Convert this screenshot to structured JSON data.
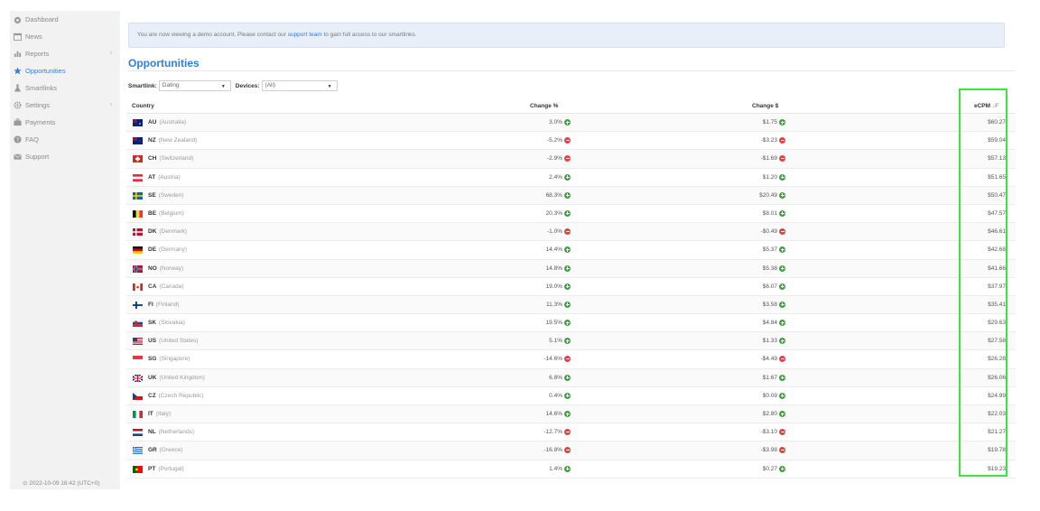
{
  "sidebar": {
    "items": [
      {
        "label": "Dashboard",
        "icon": "dashboard-icon"
      },
      {
        "label": "News",
        "icon": "calendar-icon"
      },
      {
        "label": "Reports",
        "icon": "bar-chart-icon",
        "arrow": "›"
      },
      {
        "label": "Opportunities",
        "icon": "star-icon"
      },
      {
        "label": "Smartlinks",
        "icon": "flask-icon"
      },
      {
        "label": "Settings",
        "icon": "gear-icon",
        "arrow": "›"
      },
      {
        "label": "Payments",
        "icon": "briefcase-icon"
      },
      {
        "label": "FAQ",
        "icon": "question-icon"
      },
      {
        "label": "Support",
        "icon": "envelope-icon"
      }
    ],
    "active_index": 3,
    "footer_time": "⊙ 2022-10-09 16:42 (UTC+0)"
  },
  "notice": {
    "before": "You are now viewing a demo account. Please contact our ",
    "link": "support team",
    "after": " to gain full access to our smartlinks."
  },
  "page_title": "Opportunities",
  "filters": {
    "smartlink_label": "Smartlink:",
    "smartlink_value": "Dating",
    "devices_label": "Devices:",
    "devices_value": "(All)"
  },
  "table": {
    "headers": {
      "country": "Country",
      "change_pct": "Change %",
      "change_usd": "Change $",
      "ecpm": "eCPM",
      "sort_icon": "↓F"
    },
    "rows": [
      {
        "code": "AU",
        "name": "(Australia)",
        "pct": "3.0%",
        "usd": "$1.75",
        "dir": "up",
        "ecpm": "$60.27",
        "flag": "au"
      },
      {
        "code": "NZ",
        "name": "(New Zealand)",
        "pct": "-5.2%",
        "usd": "-$3.23",
        "dir": "down",
        "ecpm": "$59.04",
        "flag": "nz"
      },
      {
        "code": "CH",
        "name": "(Switzerland)",
        "pct": "-2.9%",
        "usd": "-$1.69",
        "dir": "down",
        "ecpm": "$57.13",
        "flag": "ch"
      },
      {
        "code": "AT",
        "name": "(Austria)",
        "pct": "2.4%",
        "usd": "$1.20",
        "dir": "up",
        "ecpm": "$51.65",
        "flag": "at"
      },
      {
        "code": "SE",
        "name": "(Sweden)",
        "pct": "68.3%",
        "usd": "$20.49",
        "dir": "up",
        "ecpm": "$50.47",
        "flag": "se"
      },
      {
        "code": "BE",
        "name": "(Belgium)",
        "pct": "20.3%",
        "usd": "$8.01",
        "dir": "up",
        "ecpm": "$47.57",
        "flag": "be"
      },
      {
        "code": "DK",
        "name": "(Denmark)",
        "pct": "-1.0%",
        "usd": "-$0.49",
        "dir": "down",
        "ecpm": "$46.61",
        "flag": "dk"
      },
      {
        "code": "DE",
        "name": "(Germany)",
        "pct": "14.4%",
        "usd": "$5.37",
        "dir": "up",
        "ecpm": "$42.68",
        "flag": "de"
      },
      {
        "code": "NO",
        "name": "(Norway)",
        "pct": "14.8%",
        "usd": "$5.38",
        "dir": "up",
        "ecpm": "$41.66",
        "flag": "no"
      },
      {
        "code": "CA",
        "name": "(Canada)",
        "pct": "19.0%",
        "usd": "$6.07",
        "dir": "up",
        "ecpm": "$37.97",
        "flag": "ca"
      },
      {
        "code": "FI",
        "name": "(Finland)",
        "pct": "11.3%",
        "usd": "$3.58",
        "dir": "up",
        "ecpm": "$35.41",
        "flag": "fi"
      },
      {
        "code": "SK",
        "name": "(Slovakia)",
        "pct": "19.5%",
        "usd": "$4.84",
        "dir": "up",
        "ecpm": "$29.63",
        "flag": "sk"
      },
      {
        "code": "US",
        "name": "(United States)",
        "pct": "5.1%",
        "usd": "$1.33",
        "dir": "up",
        "ecpm": "$27.58",
        "flag": "us"
      },
      {
        "code": "SG",
        "name": "(Singapore)",
        "pct": "-14.6%",
        "usd": "-$4.49",
        "dir": "down",
        "ecpm": "$26.28",
        "flag": "sg"
      },
      {
        "code": "UK",
        "name": "(United Kingdom)",
        "pct": "6.8%",
        "usd": "$1.67",
        "dir": "up",
        "ecpm": "$26.06",
        "flag": "uk"
      },
      {
        "code": "CZ",
        "name": "(Czech Republic)",
        "pct": "0.4%",
        "usd": "$0.09",
        "dir": "up",
        "ecpm": "$24.99",
        "flag": "cz"
      },
      {
        "code": "IT",
        "name": "(Italy)",
        "pct": "14.6%",
        "usd": "$2.80",
        "dir": "up",
        "ecpm": "$22.03",
        "flag": "it"
      },
      {
        "code": "NL",
        "name": "(Netherlands)",
        "pct": "-12.7%",
        "usd": "-$3.10",
        "dir": "down",
        "ecpm": "$21.27",
        "flag": "nl"
      },
      {
        "code": "GR",
        "name": "(Greece)",
        "pct": "-16.8%",
        "usd": "-$3.98",
        "dir": "down",
        "ecpm": "$19.78",
        "flag": "gr"
      },
      {
        "code": "PT",
        "name": "(Portugal)",
        "pct": "1.4%",
        "usd": "$0.27",
        "dir": "up",
        "ecpm": "$19.23",
        "flag": "pt"
      }
    ]
  },
  "colors": {
    "accent": "#2f7ed8",
    "up": "#3aa53a",
    "down": "#e04343",
    "highlight": "#39e639"
  }
}
